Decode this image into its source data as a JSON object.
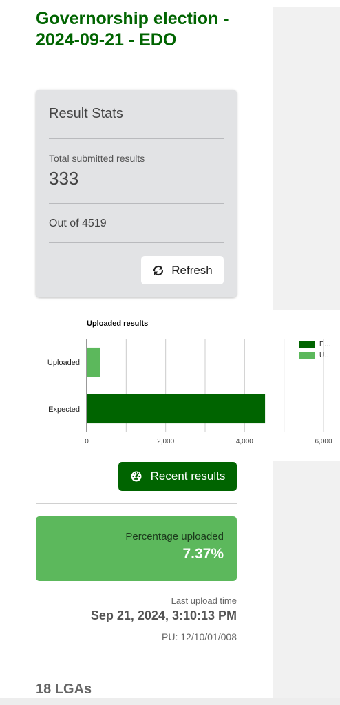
{
  "header": {
    "title": "Governorship election - 2024-09-21 - EDO"
  },
  "stats_card": {
    "title": "Result Stats",
    "total_label": "Total submitted results",
    "total_value": "333",
    "out_of": "Out of 4519",
    "refresh_label": "Refresh",
    "refresh_icon": "refresh-icon"
  },
  "chart_data": {
    "type": "bar",
    "orientation": "horizontal",
    "title": "Uploaded results",
    "categories": [
      "Uploaded",
      "Expected"
    ],
    "series": [
      {
        "name": "E…",
        "values": [
          null,
          4519
        ],
        "color": "#006400"
      },
      {
        "name": "U…",
        "values": [
          333,
          null
        ],
        "color": "#5cb85c"
      }
    ],
    "x_ticks": [
      "0",
      "2,000",
      "4,000",
      "6,000"
    ],
    "xlim": [
      0,
      6000
    ],
    "grid": true,
    "legend_position": "right"
  },
  "actions": {
    "recent_label": "Recent results",
    "recent_icon": "dashboard-icon"
  },
  "percentage": {
    "label": "Percentage uploaded",
    "value": "7.37%",
    "color": "#5cb85c"
  },
  "upload": {
    "label": "Last upload time",
    "time": "Sep 21, 2024, 3:10:13 PM",
    "pu": "PU: 12/10/01/008"
  },
  "lgas": {
    "count_label": "18 LGAs"
  },
  "colors": {
    "brand": "#006400",
    "accent": "#5cb85c"
  }
}
